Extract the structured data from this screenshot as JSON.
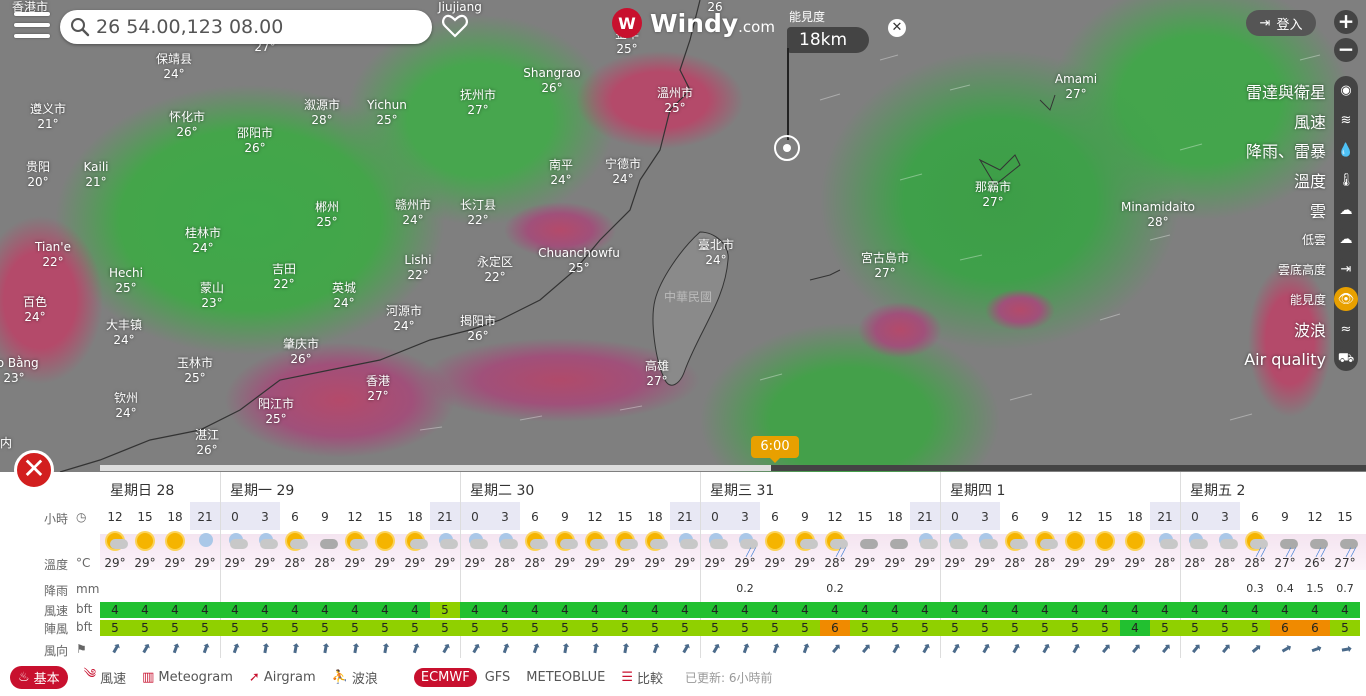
{
  "search": {
    "value": "26 54.00,123 08.00"
  },
  "logo": {
    "name": "Windy",
    "domain": ".com"
  },
  "visibility_readout": {
    "label": "能見度",
    "value": "18km"
  },
  "login": {
    "label": "登入"
  },
  "zoom": {
    "in": "+",
    "out": "−"
  },
  "layers": [
    {
      "label": "雷達與衛星",
      "icon": "globe-icon",
      "size": "big",
      "active": false
    },
    {
      "label": "風速",
      "icon": "wind-icon",
      "size": "big",
      "active": false
    },
    {
      "label": "降雨、雷暴",
      "icon": "raindrop-icon",
      "size": "big",
      "active": false
    },
    {
      "label": "溫度",
      "icon": "thermometer-icon",
      "size": "big",
      "active": false
    },
    {
      "label": "雲",
      "icon": "clouds-icon",
      "size": "big",
      "active": false
    },
    {
      "label": "低雲",
      "icon": "low-clouds-icon",
      "size": "small",
      "active": false
    },
    {
      "label": "雲底高度",
      "icon": "cloud-base-icon",
      "size": "small",
      "active": false
    },
    {
      "label": "能見度",
      "icon": "eye-icon",
      "size": "small",
      "active": true
    },
    {
      "label": "波浪",
      "icon": "waves-icon",
      "size": "big",
      "active": false
    },
    {
      "label": "Air quality",
      "icon": "car-icon",
      "size": "big",
      "active": false
    }
  ],
  "map_labels": [
    {
      "name": "香港市",
      "temp": ""
    },
    {
      "name": "Jiujiang",
      "temp": ""
    },
    {
      "name": "",
      "temp": "26"
    },
    {
      "name": "保靖县",
      "temp": "24°"
    },
    {
      "name": "",
      "temp": "27°"
    },
    {
      "name": "",
      "temp": "26"
    },
    {
      "name": "Shangrao",
      "temp": "26°"
    },
    {
      "name": "溫州市",
      "temp": "25°"
    },
    {
      "name": "Amami",
      "temp": "27°"
    },
    {
      "name": "遵义市",
      "temp": "21°"
    },
    {
      "name": "怀化市",
      "temp": "26°"
    },
    {
      "name": "溆源市",
      "temp": "28°"
    },
    {
      "name": "Yichun",
      "temp": "25°"
    },
    {
      "name": "抚州市",
      "temp": "27°"
    },
    {
      "name": "邵阳市",
      "temp": "26°"
    },
    {
      "name": "南平",
      "temp": "24°"
    },
    {
      "name": "宁德市",
      "temp": "24°"
    },
    {
      "name": "贵阳",
      "temp": "20°"
    },
    {
      "name": "Kaili",
      "temp": "21°"
    },
    {
      "name": "那霸市",
      "temp": "27°"
    },
    {
      "name": "郴州",
      "temp": "25°"
    },
    {
      "name": "赣州市",
      "temp": "24°"
    },
    {
      "name": "长汀县",
      "temp": "22°"
    },
    {
      "name": "Minamidaito",
      "temp": "28°"
    },
    {
      "name": "桂林市",
      "temp": "24°"
    },
    {
      "name": "臺北市",
      "temp": "24°"
    },
    {
      "name": "Tian'e",
      "temp": "22°"
    },
    {
      "name": "Chuanchowfu",
      "temp": "25°"
    },
    {
      "name": "宮古島市",
      "temp": "27°"
    },
    {
      "name": "Hechi",
      "temp": "25°"
    },
    {
      "name": "吉田",
      "temp": "22°"
    },
    {
      "name": "Lishi",
      "temp": "22°"
    },
    {
      "name": "永定区",
      "temp": "22°"
    },
    {
      "name": "中華民國",
      "temp": ""
    },
    {
      "name": "蒙山",
      "temp": "23°"
    },
    {
      "name": "英城",
      "temp": "24°"
    },
    {
      "name": "百色",
      "temp": "24°"
    },
    {
      "name": "河源市",
      "temp": "24°"
    },
    {
      "name": "揭阳市",
      "temp": "26°"
    },
    {
      "name": "大丰镇",
      "temp": "24°"
    },
    {
      "name": "肇庆市",
      "temp": "26°"
    },
    {
      "name": "高雄",
      "temp": "27°"
    },
    {
      "name": "玉林市",
      "temp": "25°"
    },
    {
      "name": "ao Bằng",
      "temp": "23°"
    },
    {
      "name": "香港",
      "temp": "27°"
    },
    {
      "name": "钦州",
      "temp": "24°"
    },
    {
      "name": "阳江市",
      "temp": "25°"
    },
    {
      "name": "湛江",
      "temp": "26°"
    },
    {
      "name": "内",
      "temp": ""
    },
    {
      "name": "金华",
      "temp": "25°"
    }
  ],
  "timeline": {
    "current_time": "6:00",
    "progress": 0.53
  },
  "forecast": {
    "days": [
      "星期日 28",
      "星期一 29",
      "星期二 30",
      "星期三 31",
      "星期四 1",
      "星期五 2"
    ],
    "row_labels": {
      "hours": "小時",
      "temp": "溫度",
      "temp_unit": "°C",
      "rain": "降雨",
      "rain_unit": "mm",
      "wind": "風速",
      "wind_unit": "bft",
      "gust": "陣風",
      "gust_unit": "bft",
      "dir": "風向"
    },
    "hours": [
      "12",
      "15",
      "18",
      "21",
      "0",
      "3",
      "6",
      "9",
      "12",
      "15",
      "18",
      "21",
      "0",
      "3",
      "6",
      "9",
      "12",
      "15",
      "18",
      "21",
      "0",
      "3",
      "6",
      "9",
      "12",
      "15",
      "18",
      "21",
      "0",
      "3",
      "6",
      "9",
      "12",
      "15",
      "18",
      "21",
      "0",
      "3",
      "6",
      "9",
      "12",
      "15"
    ],
    "weather": [
      "pc",
      "sun",
      "sun",
      "moon",
      "mc",
      "mc",
      "pc",
      "cl",
      "pc",
      "sun",
      "pc",
      "mc",
      "mc",
      "mc",
      "pc",
      "pc",
      "pc",
      "pc",
      "pc",
      "mc",
      "mc",
      "mr",
      "sun",
      "pc",
      "pr",
      "cl",
      "cl",
      "mc",
      "mc",
      "mc",
      "pc",
      "pc",
      "sun",
      "sun",
      "sun",
      "mc",
      "mc",
      "mc",
      "pr",
      "cr",
      "cr",
      "cr"
    ],
    "temps": [
      "29°",
      "29°",
      "29°",
      "29°",
      "29°",
      "29°",
      "28°",
      "28°",
      "29°",
      "29°",
      "29°",
      "29°",
      "29°",
      "28°",
      "28°",
      "29°",
      "29°",
      "29°",
      "29°",
      "29°",
      "29°",
      "29°",
      "29°",
      "29°",
      "28°",
      "29°",
      "29°",
      "29°",
      "29°",
      "29°",
      "28°",
      "28°",
      "29°",
      "29°",
      "29°",
      "28°",
      "28°",
      "28°",
      "28°",
      "27°",
      "26°",
      "27°"
    ],
    "rain": [
      "",
      "",
      "",
      "",
      "",
      "",
      "",
      "",
      "",
      "",
      "",
      "",
      "",
      "",
      "",
      "",
      "",
      "",
      "",
      "",
      "",
      "0.2",
      "",
      "",
      "0.2",
      "",
      "",
      "",
      "",
      "",
      "",
      "",
      "",
      "",
      "",
      "",
      "",
      "",
      "0.3",
      "0.4",
      "1.5",
      "0.7"
    ],
    "wind": [
      4,
      4,
      4,
      4,
      4,
      4,
      4,
      4,
      4,
      4,
      4,
      5,
      4,
      4,
      4,
      4,
      4,
      4,
      4,
      4,
      4,
      4,
      4,
      4,
      4,
      4,
      4,
      4,
      4,
      4,
      4,
      4,
      4,
      4,
      4,
      4,
      4,
      4,
      4,
      4,
      4,
      4
    ],
    "gust": [
      5,
      5,
      5,
      5,
      5,
      5,
      5,
      5,
      5,
      5,
      5,
      5,
      5,
      5,
      5,
      5,
      5,
      5,
      5,
      5,
      5,
      5,
      5,
      5,
      6,
      5,
      5,
      5,
      5,
      5,
      5,
      5,
      5,
      5,
      4,
      5,
      5,
      5,
      5,
      6,
      6,
      5
    ],
    "dir_deg": [
      30,
      30,
      20,
      20,
      20,
      10,
      10,
      10,
      10,
      10,
      20,
      30,
      30,
      20,
      20,
      10,
      10,
      10,
      20,
      30,
      30,
      20,
      20,
      20,
      40,
      40,
      30,
      30,
      30,
      30,
      30,
      30,
      30,
      40,
      40,
      40,
      40,
      40,
      50,
      60,
      70,
      80
    ],
    "colors": {
      "bft4": "#22c030",
      "bft5": "#90d000",
      "bft6": "#f08a00",
      "accent": "#c8102e"
    }
  },
  "toolbar": {
    "basic": "基本",
    "wind": "風速",
    "meteogram": "Meteogram",
    "airgram": "Airgram",
    "waves": "波浪",
    "ecmwf": "ECMWF",
    "gfs": "GFS",
    "meteoblue": "METEOBLUE",
    "compare": "比較",
    "updated": "已更新: 6小時前"
  }
}
